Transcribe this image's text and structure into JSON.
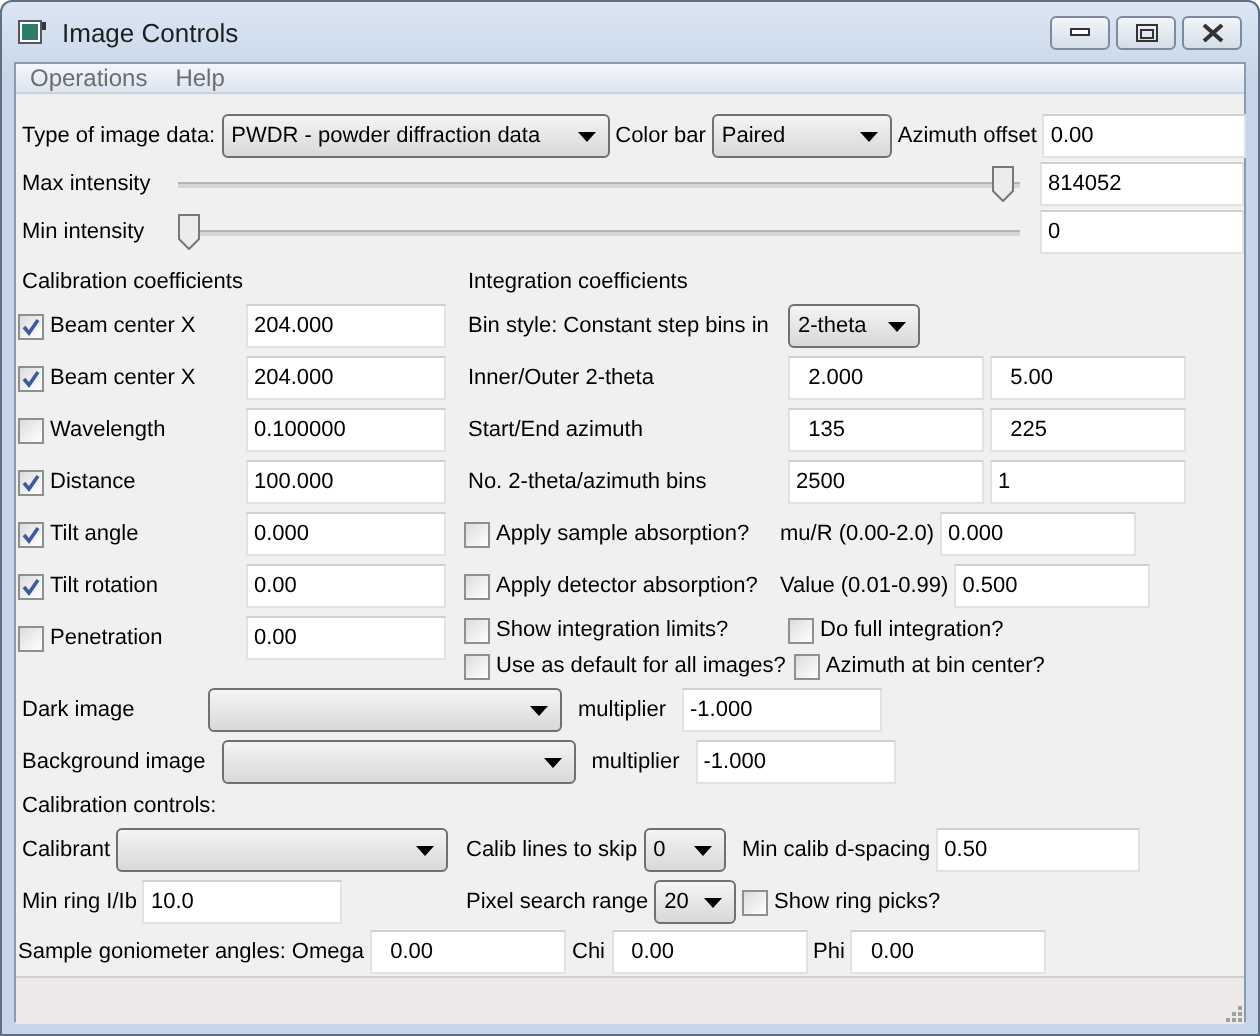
{
  "window": {
    "title": "Image Controls"
  },
  "menu": [
    {
      "label": "Operations"
    },
    {
      "label": "Help"
    }
  ],
  "image_type": {
    "label": "Type of image data:",
    "value": "PWDR - powder diffraction data"
  },
  "color_bar": {
    "label": "Color bar",
    "value": "Paired"
  },
  "azimuth_offset": {
    "label": "Azimuth offset",
    "value": "0.00"
  },
  "intensity": [
    {
      "label": "Max intensity",
      "level": 0.99,
      "value": "814052"
    },
    {
      "label": "Min intensity",
      "level": 0,
      "value": "0"
    }
  ],
  "calibration": {
    "title": "Calibration coefficients",
    "items": [
      {
        "label": "Beam center X",
        "checked": true,
        "value": "204.000"
      },
      {
        "label": "Beam center X",
        "checked": true,
        "value": "204.000"
      },
      {
        "label": "Wavelength",
        "checked": false,
        "value": "0.100000"
      },
      {
        "label": "Distance",
        "checked": true,
        "value": "100.000"
      },
      {
        "label": "Tilt angle",
        "checked": true,
        "value": "0.000"
      },
      {
        "label": "Tilt rotation",
        "checked": true,
        "value": "0.00"
      },
      {
        "label": "Penetration",
        "checked": false,
        "value": "0.00"
      }
    ]
  },
  "integration": {
    "title": "Integration coefficients",
    "bin_style": {
      "label": "Bin style: Constant step bins in",
      "value": "2-theta"
    },
    "pairs": [
      {
        "label": "Inner/Outer 2-theta",
        "values": [
          "  2.000",
          "  5.00"
        ]
      },
      {
        "label": "Start/End azimuth",
        "values": [
          "  135",
          "  225"
        ]
      },
      {
        "label": "No. 2-theta/azimuth bins",
        "values": [
          "2500",
          "1"
        ]
      }
    ],
    "absorption": [
      {
        "label": "Apply sample absorption?",
        "checked": false,
        "param_label": "mu/R (0.00-2.0)",
        "value": "0.000"
      },
      {
        "label": "Apply detector absorption?",
        "checked": false,
        "param_label": "Value (0.01-0.99)",
        "value": "0.500"
      }
    ],
    "options": [
      {
        "label": "Show integration limits?",
        "checked": false
      },
      {
        "label": "Do full integration?",
        "checked": false
      },
      {
        "label": "Use as default for all images?",
        "checked": false
      },
      {
        "label": "Azimuth at bin center?",
        "checked": false
      }
    ]
  },
  "image_rows": [
    {
      "label": "Dark image",
      "multiplier_label": "multiplier",
      "multiplier": "-1.000"
    },
    {
      "label": "Background image",
      "multiplier_label": "multiplier",
      "multiplier": "-1.000"
    }
  ],
  "calibration_controls": {
    "title": "Calibration controls:",
    "calibrant": {
      "label": "Calibrant"
    },
    "lines_to_skip": {
      "label": "Calib lines to skip",
      "value": "0"
    },
    "min_d_spacing": {
      "label": "Min calib d-spacing",
      "value": "0.50"
    },
    "min_ring": {
      "label": "Min ring I/Ib",
      "value": "10.0"
    },
    "pixel_search": {
      "label": "Pixel search range",
      "value": "20"
    },
    "show_ring_picks": {
      "label": "Show ring picks?",
      "checked": false
    }
  },
  "goniometer": {
    "label": "Sample goniometer angles:",
    "angles": [
      {
        "label": "Omega",
        "value": "  0.00"
      },
      {
        "label": "Chi",
        "value": "  0.00"
      },
      {
        "label": "Phi",
        "value": "  0.00"
      }
    ]
  }
}
